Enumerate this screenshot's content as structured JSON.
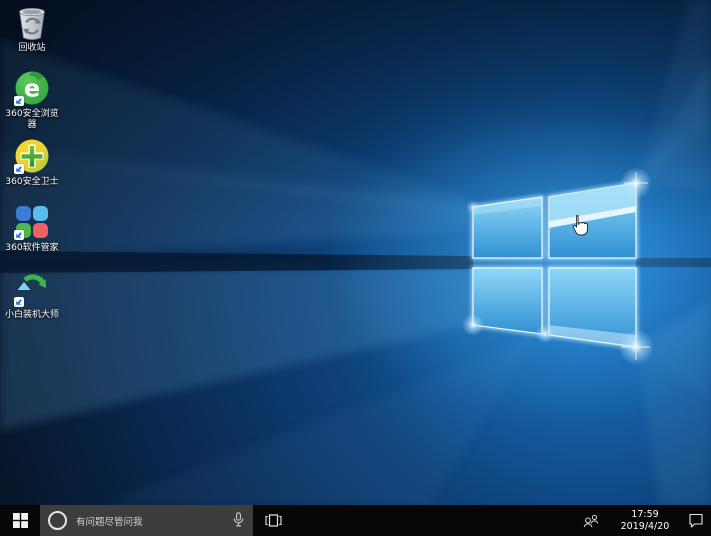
{
  "desktop": {
    "icons": [
      {
        "id": "recycle-bin",
        "label": "回收站"
      },
      {
        "id": "360-browser",
        "label": "360安全浏览器"
      },
      {
        "id": "360-safeguard",
        "label": "360安全卫士"
      },
      {
        "id": "360-software-manager",
        "label": "360软件管家"
      },
      {
        "id": "xiaobai-installer",
        "label": "小白装机大师"
      }
    ]
  },
  "taskbar": {
    "search": {
      "placeholder": "有问题尽管问我"
    },
    "clock": {
      "time": "17:59",
      "date": "2019/4/20"
    }
  },
  "colors": {
    "taskbar_bg": "#070707",
    "search_box_bg": "#3d3d3d",
    "wallpaper_dark": "#061830",
    "wallpaper_glow": "#1f83d2",
    "logo_pane_blue": "#5ec1f0",
    "shortcut_arrow_blue": "#2a6fe0"
  }
}
